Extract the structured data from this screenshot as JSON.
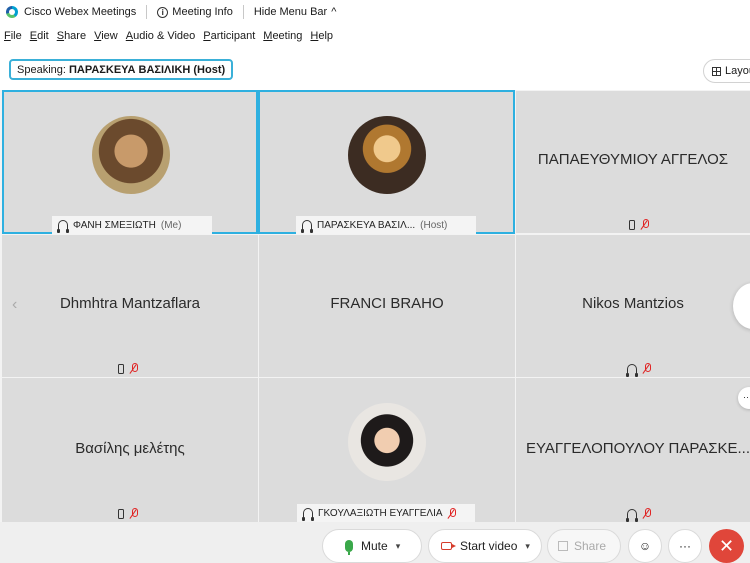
{
  "titlebar": {
    "app_name": "Cisco Webex Meetings",
    "meeting_info": "Meeting Info",
    "hide_menu": "Hide Menu Bar",
    "hide_menu_glyph": "^"
  },
  "menu": [
    "File",
    "Edit",
    "Share",
    "View",
    "Audio & Video",
    "Participant",
    "Meeting",
    "Help"
  ],
  "speaking": {
    "prefix": "Speaking:",
    "name": "ΠΑΡΑΣΚΕΥΑ ΒΑΣΙΛΙΚΗ (Host)"
  },
  "layout_label": "Layout",
  "tiles": [
    {
      "name": "ΦΑΝΗ ΣΜΕΞΙΩΤΗ",
      "sub": "(Me)",
      "video": true,
      "active": true
    },
    {
      "name": "ΠΑΡΑΣΚΕΥΑ ΒΑΣΙΛ...",
      "sub": "(Host)",
      "video": true,
      "active": true
    },
    {
      "name": "ΠΑΠΑΕΥΘΥΜΙΟΥ ΑΓΓΕΛΟΣ",
      "video": false
    },
    {
      "name": "Dhmhtra Mantzaflara",
      "video": false
    },
    {
      "name": "FRANCI BRAHO",
      "video": false
    },
    {
      "name": "Nikos Mantzios",
      "video": false
    },
    {
      "name": "Βασίλης μελέτης",
      "video": false
    },
    {
      "name": "ΓΚΟΥΛΑΞΙΩΤΗ ΕΥΑΓΓΕΛΙΑ",
      "video": true
    },
    {
      "name": "ΕΥΑΓΓΕΛΟΠΟΥΛΟΥ ΠΑΡΑΣΚΕ...",
      "video": false
    }
  ],
  "toolbar": {
    "mute": "Mute",
    "start_video": "Start video",
    "share": "Share",
    "more": "···",
    "end": "✕"
  },
  "colors": {
    "active_border": "#2eb0e0",
    "end_button": "#e0463a",
    "muted_icon": "#e02424",
    "mic_on": "#3aa84a"
  }
}
